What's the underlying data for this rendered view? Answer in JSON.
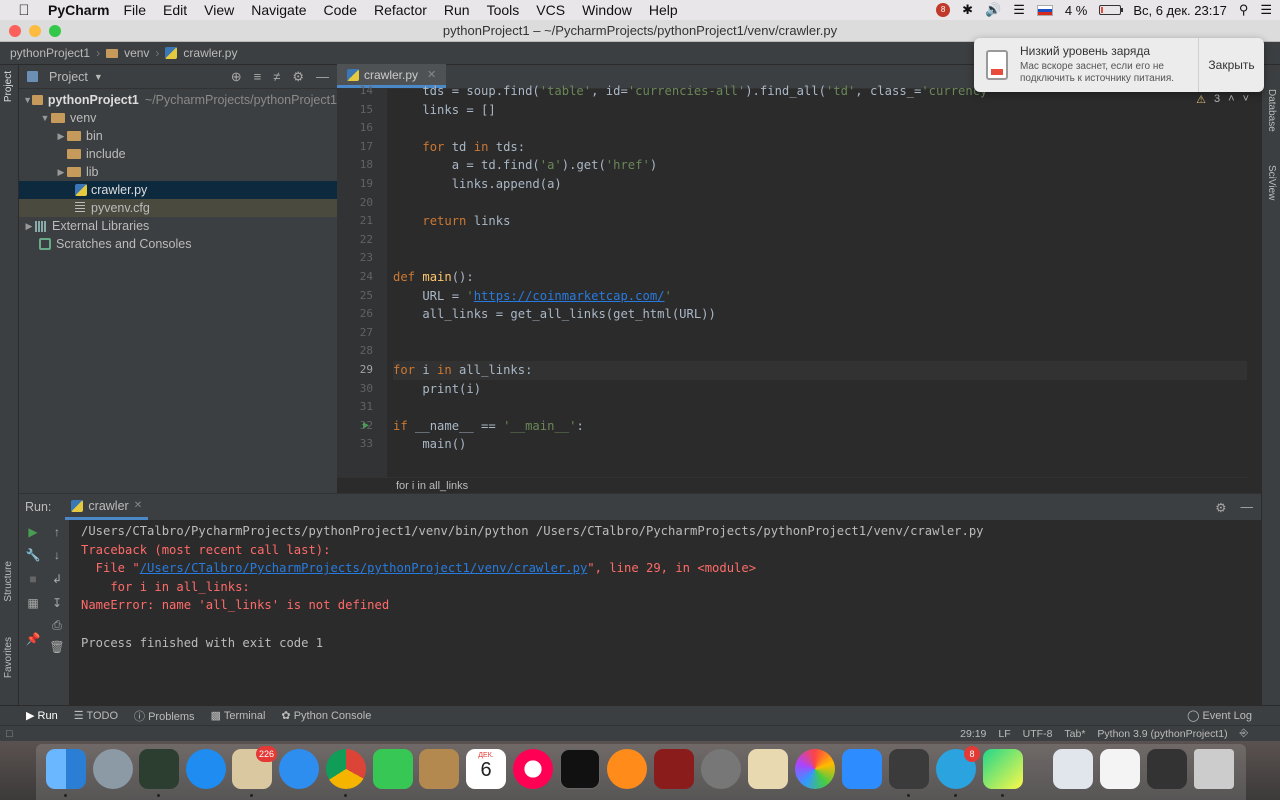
{
  "menubar": {
    "app": "PyCharm",
    "items": [
      "File",
      "Edit",
      "View",
      "Navigate",
      "Code",
      "Refactor",
      "Run",
      "Tools",
      "VCS",
      "Window",
      "Help"
    ],
    "record_badge": "8",
    "battery": "4 %",
    "datetime": "Вс, 6 дек.  23:17"
  },
  "window": {
    "title": "pythonProject1 – ~/PycharmProjects/pythonProject1/venv/crawler.py"
  },
  "navbar": {
    "crumbs": [
      "pythonProject1",
      "venv",
      "crawler.py"
    ]
  },
  "sidebar_labels": {
    "project": "Project",
    "structure": "Structure",
    "favorites": "Favorites",
    "database": "Database",
    "sciview": "SciView"
  },
  "project": {
    "header": "Project",
    "root_name": "pythonProject1",
    "root_path": "~/PycharmProjects/pythonProject1",
    "venv": "venv",
    "bin": "bin",
    "include": "include",
    "lib": "lib",
    "crawler": "crawler.py",
    "pyvenv": "pyvenv.cfg",
    "external": "External Libraries",
    "scratches": "Scratches and Consoles"
  },
  "editor": {
    "tab": "crawler.py",
    "inspections": "3",
    "breadcrumb": "for i in all_links",
    "line_numbers": [
      "14",
      "15",
      "16",
      "17",
      "18",
      "19",
      "20",
      "21",
      "22",
      "23",
      "24",
      "25",
      "26",
      "27",
      "28",
      "29",
      "30",
      "31",
      "32",
      "33"
    ]
  },
  "code": {
    "l14_pre": "    tds = soup.find(",
    "l14_s1": "'table'",
    "l14_mid": ", id=",
    "l14_s2": "'currencies-all'",
    "l14_mid2": ").find_all(",
    "l14_s3": "'td'",
    "l14_mid3": ", class_=",
    "l14_s4": "'currency",
    "l15": "    links = []",
    "l17_kw": "for",
    "l17_a": " td ",
    "l17_kw2": "in",
    "l17_b": " tds:",
    "l18_a": "        a = td.find(",
    "l18_s": "'a'",
    "l18_b": ").get(",
    "l18_s2": "'href'",
    "l18_c": ")",
    "l19": "        links.append(a)",
    "l21_kw": "return",
    "l21_b": " links",
    "l24_kw": "def",
    "l24_fn": "main",
    "l24_b": "():",
    "l25_a": "    URL = ",
    "l25_q": "'",
    "l25_link": "https://coinmarketcap.com/",
    "l26": "    all_links = get_all_links(get_html(URL))",
    "l29_kw": "for",
    "l29_a": " i ",
    "l29_kw2": "in",
    "l29_b": " all_links:",
    "l30": "    print(i)",
    "l32_kw": "if",
    "l32_a": " __name__ == ",
    "l32_s": "'__main__'",
    "l32_b": ":",
    "l33": "    main()"
  },
  "notification": {
    "title": "Низкий уровень заряда",
    "body_line1": "Mac вскоре заснет, если его не",
    "body_line2": "подключить к источнику питания.",
    "close": "Закрыть"
  },
  "run": {
    "label": "Run:",
    "config": "crawler",
    "lines": {
      "cmd": "/Users/CTalbro/PycharmProjects/pythonProject1/venv/bin/python /Users/CTalbro/PycharmProjects/pythonProject1/venv/crawler.py",
      "tb": "Traceback (most recent call last):",
      "file_pre": "  File \"",
      "file_link": "/Users/CTalbro/PycharmProjects/pythonProject1/venv/crawler.py",
      "file_post": "\", line 29, in <module>",
      "src": "    for i in all_links:",
      "err": "NameError: name 'all_links' is not defined",
      "exit": "Process finished with exit code 1"
    }
  },
  "toolbar_bottom": {
    "run": "Run",
    "todo": "TODO",
    "problems": "Problems",
    "terminal": "Terminal",
    "python_console": "Python Console",
    "event_log": "Event Log"
  },
  "status": {
    "position": "29:19",
    "line_sep": "LF",
    "encoding": "UTF-8",
    "indent": "Tab*",
    "interpreter": "Python 3.9 (pythonProject1)"
  },
  "dock": {
    "mail_badge": "226",
    "calendar_month": "ДЕК.",
    "calendar_day": "6",
    "telegram_badge": "8"
  }
}
